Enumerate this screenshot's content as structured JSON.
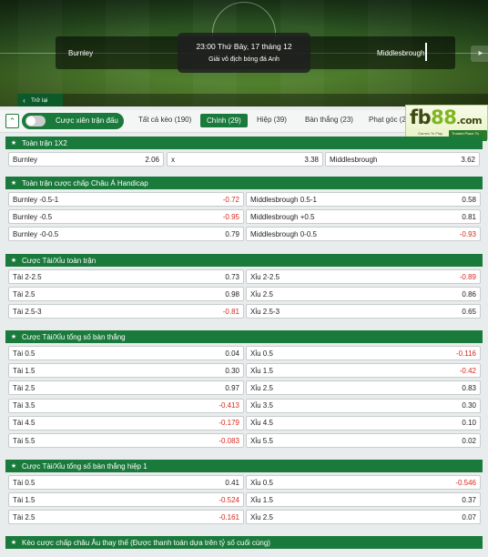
{
  "match": {
    "home": "Burnley",
    "away": "Middlesbrough",
    "datetime": "23:00 Thứ Bảy, 17 tháng 12",
    "league": "Giải vô địch bóng đá Anh"
  },
  "back_label": "Trở lại",
  "toggle_label": "Cược xiên trận đấu",
  "tabs": [
    {
      "label": "Tất cả kèo (190)",
      "active": false
    },
    {
      "label": "Chính (29)",
      "active": true
    },
    {
      "label": "Hiệp (39)",
      "active": false
    },
    {
      "label": "Bàn thắng (23)",
      "active": false
    },
    {
      "label": "Phạt góc (22",
      "active": false
    }
  ],
  "logo": {
    "main": "fb",
    "accent": "88",
    "suffix": ".com",
    "tagline_left": "Games To Play",
    "tagline_right": "Trusted Place To Bet"
  },
  "sections": [
    {
      "title": "Toàn trận 1X2",
      "three_col": true,
      "rows": [
        {
          "cells": [
            {
              "label": "Burnley",
              "value": "2.06"
            },
            {
              "label": "x",
              "value": "3.38"
            },
            {
              "label": "Middlesbrough",
              "value": "3.62"
            }
          ]
        }
      ]
    },
    {
      "title": "Toàn trận cược chấp Châu Á Handicap",
      "rows": [
        {
          "left": {
            "label": "Burnley -0.5-1",
            "value": "-0.72"
          },
          "right": {
            "label": "Middlesbrough 0.5-1",
            "value": "0.58"
          }
        },
        {
          "left": {
            "label": "Burnley -0.5",
            "value": "-0.95"
          },
          "right": {
            "label": "Middlesbrough +0.5",
            "value": "0.81"
          }
        },
        {
          "left": {
            "label": "Burnley -0-0.5",
            "value": "0.79"
          },
          "right": {
            "label": "Middlesbrough 0-0.5",
            "value": "-0.93"
          }
        }
      ]
    },
    {
      "title": "Cược Tài/Xỉu toàn trận",
      "rows": [
        {
          "left": {
            "label": "Tài 2-2.5",
            "value": "0.73"
          },
          "right": {
            "label": "Xỉu 2-2.5",
            "value": "-0.89"
          }
        },
        {
          "left": {
            "label": "Tài 2.5",
            "value": "0.98"
          },
          "right": {
            "label": "Xỉu 2.5",
            "value": "0.86"
          }
        },
        {
          "left": {
            "label": "Tài 2.5-3",
            "value": "-0.81"
          },
          "right": {
            "label": "Xỉu 2.5-3",
            "value": "0.65"
          }
        }
      ]
    },
    {
      "title": "Cược Tài/Xỉu tổng số bàn thắng",
      "rows": [
        {
          "left": {
            "label": "Tài 0.5",
            "value": "0.04"
          },
          "right": {
            "label": "Xỉu 0.5",
            "value": "-0.116"
          }
        },
        {
          "left": {
            "label": "Tài 1.5",
            "value": "0.30"
          },
          "right": {
            "label": "Xỉu 1.5",
            "value": "-0.42"
          }
        },
        {
          "left": {
            "label": "Tài 2.5",
            "value": "0.97"
          },
          "right": {
            "label": "Xỉu 2.5",
            "value": "0.83"
          }
        },
        {
          "left": {
            "label": "Tài 3.5",
            "value": "-0.413"
          },
          "right": {
            "label": "Xỉu 3.5",
            "value": "0.30"
          }
        },
        {
          "left": {
            "label": "Tài 4.5",
            "value": "-0.179"
          },
          "right": {
            "label": "Xỉu 4.5",
            "value": "0.10"
          }
        },
        {
          "left": {
            "label": "Tài 5.5",
            "value": "-0.083"
          },
          "right": {
            "label": "Xỉu 5.5",
            "value": "0.02"
          }
        }
      ]
    },
    {
      "title": "Cược Tài/Xỉu tổng số bàn thắng hiệp 1",
      "rows": [
        {
          "left": {
            "label": "Tài 0.5",
            "value": "0.41"
          },
          "right": {
            "label": "Xỉu 0.5",
            "value": "-0.546"
          }
        },
        {
          "left": {
            "label": "Tài 1.5",
            "value": "-0.524"
          },
          "right": {
            "label": "Xỉu 1.5",
            "value": "0.37"
          }
        },
        {
          "left": {
            "label": "Tài 2.5",
            "value": "-0.161"
          },
          "right": {
            "label": "Xỉu 2.5",
            "value": "0.07"
          }
        }
      ]
    },
    {
      "title": "Kèo cược chấp châu Âu thay thế (Được thanh toán dựa trên tỷ số cuối cùng)",
      "rows": []
    }
  ],
  "colors": {
    "brand_green": "#1a7a3c",
    "negative": "#d9281e",
    "back_button": "#0c5a2a"
  },
  "icons": {
    "collapse": "double-chevron-up-icon",
    "back": "chevron-left-icon",
    "section": "star-icon",
    "side": "megaphone-icon"
  }
}
